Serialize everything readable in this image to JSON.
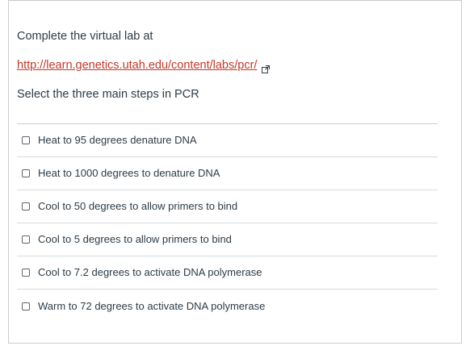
{
  "quiz": {
    "intro_text": "Complete the virtual lab at",
    "link_text": "http://learn.genetics.utah.edu/content/labs/pcr/",
    "external_link_icon": "external-link-icon",
    "question_text": "Select the three main steps in PCR",
    "answers": [
      {
        "label": "Heat to 95 degrees denature DNA",
        "checked": false
      },
      {
        "label": "Heat to 1000 degrees to denature DNA",
        "checked": false
      },
      {
        "label": "Cool to 50 degrees to allow primers to bind",
        "checked": false
      },
      {
        "label": "Cool to 5 degrees to allow primers to bind",
        "checked": false
      },
      {
        "label": "Cool to 7.2 degrees to activate DNA polymerase",
        "checked": false
      },
      {
        "label": "Warm to 72 degrees to activate DNA polymerase",
        "checked": false
      }
    ]
  },
  "colors": {
    "link": "#c0392b",
    "text": "#2d3b45",
    "border": "#c7cdd1"
  }
}
